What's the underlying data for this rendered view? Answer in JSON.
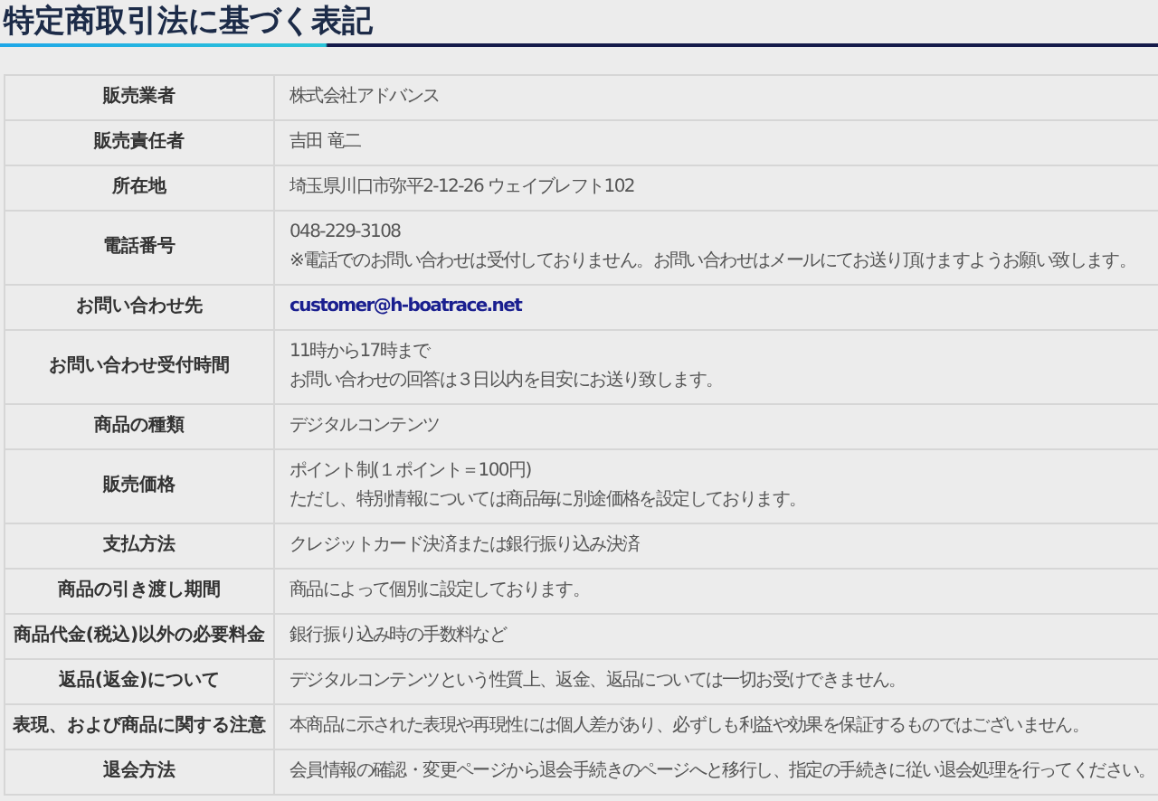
{
  "page_title": "特定商取引法に基づく表記",
  "table": {
    "rows": [
      {
        "label": "販売業者",
        "kind": "text",
        "lines": [
          "株式会社アドバンス"
        ]
      },
      {
        "label": "販売責任者",
        "kind": "text",
        "lines": [
          "吉田 竜二"
        ]
      },
      {
        "label": "所在地",
        "kind": "text",
        "lines": [
          "埼玉県川口市弥平2-12-26 ウェイブレフト102"
        ]
      },
      {
        "label": "電話番号",
        "kind": "text",
        "lines": [
          "048-229-3108",
          "※電話でのお問い合わせは受付しておりません。お問い合わせはメールにてお送り頂けますようお願い致します。"
        ]
      },
      {
        "label": "お問い合わせ先",
        "kind": "link",
        "lines": [
          "customer@h-boatrace.net"
        ]
      },
      {
        "label": "お問い合わせ受付時間",
        "kind": "text",
        "lines": [
          "11時から17時まで",
          "お問い合わせの回答は３日以内を目安にお送り致します。"
        ]
      },
      {
        "label": "商品の種類",
        "kind": "text",
        "lines": [
          "デジタルコンテンツ"
        ]
      },
      {
        "label": "販売価格",
        "kind": "text",
        "lines": [
          "ポイント制(１ポイント＝100円)",
          "ただし、特別情報については商品毎に別途価格を設定しております。"
        ]
      },
      {
        "label": "支払方法",
        "kind": "text",
        "lines": [
          "クレジットカード決済または銀行振り込み決済"
        ]
      },
      {
        "label": "商品の引き渡し期間",
        "kind": "text",
        "lines": [
          "商品によって個別に設定しております。"
        ]
      },
      {
        "label": "商品代金(税込)以外の必要料金",
        "kind": "text",
        "lines": [
          "銀行振り込み時の手数料など"
        ]
      },
      {
        "label": "返品(返金)について",
        "kind": "text",
        "lines": [
          "デジタルコンテンツという性質上、返金、返品については一切お受けできません。"
        ]
      },
      {
        "label": "表現、および商品に関する注意",
        "kind": "text",
        "lines": [
          "本商品に示された表現や再現性には個人差があり、必ずしも利益や効果を保証するものではございません。"
        ]
      },
      {
        "label": "退会方法",
        "kind": "text",
        "lines": [
          "会員情報の確認・変更ページから退会手続きのページへと移行し、指定の手続きに従い退会処理を行ってください。"
        ]
      }
    ]
  }
}
